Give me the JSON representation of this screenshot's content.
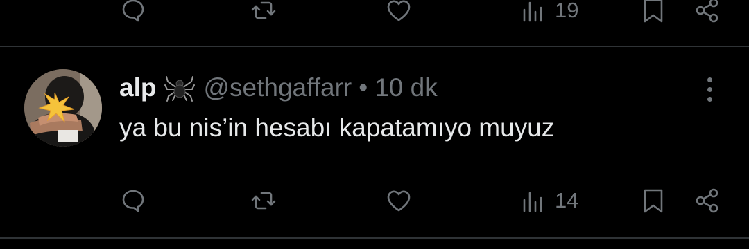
{
  "top_actions": {
    "views_count": "19"
  },
  "tweet": {
    "author_name": "alp",
    "emoji_icon": "spider-icon",
    "handle": "@sethgaffarr",
    "separator": "•",
    "time": "10 dk",
    "text": "ya bu nis’in hesabı kapatamıyo muyuz"
  },
  "bottom_actions": {
    "views_count": "14"
  },
  "colors": {
    "background": "#000000",
    "text": "#e7e9ea",
    "muted": "#71767b",
    "divider": "#2f3336"
  }
}
